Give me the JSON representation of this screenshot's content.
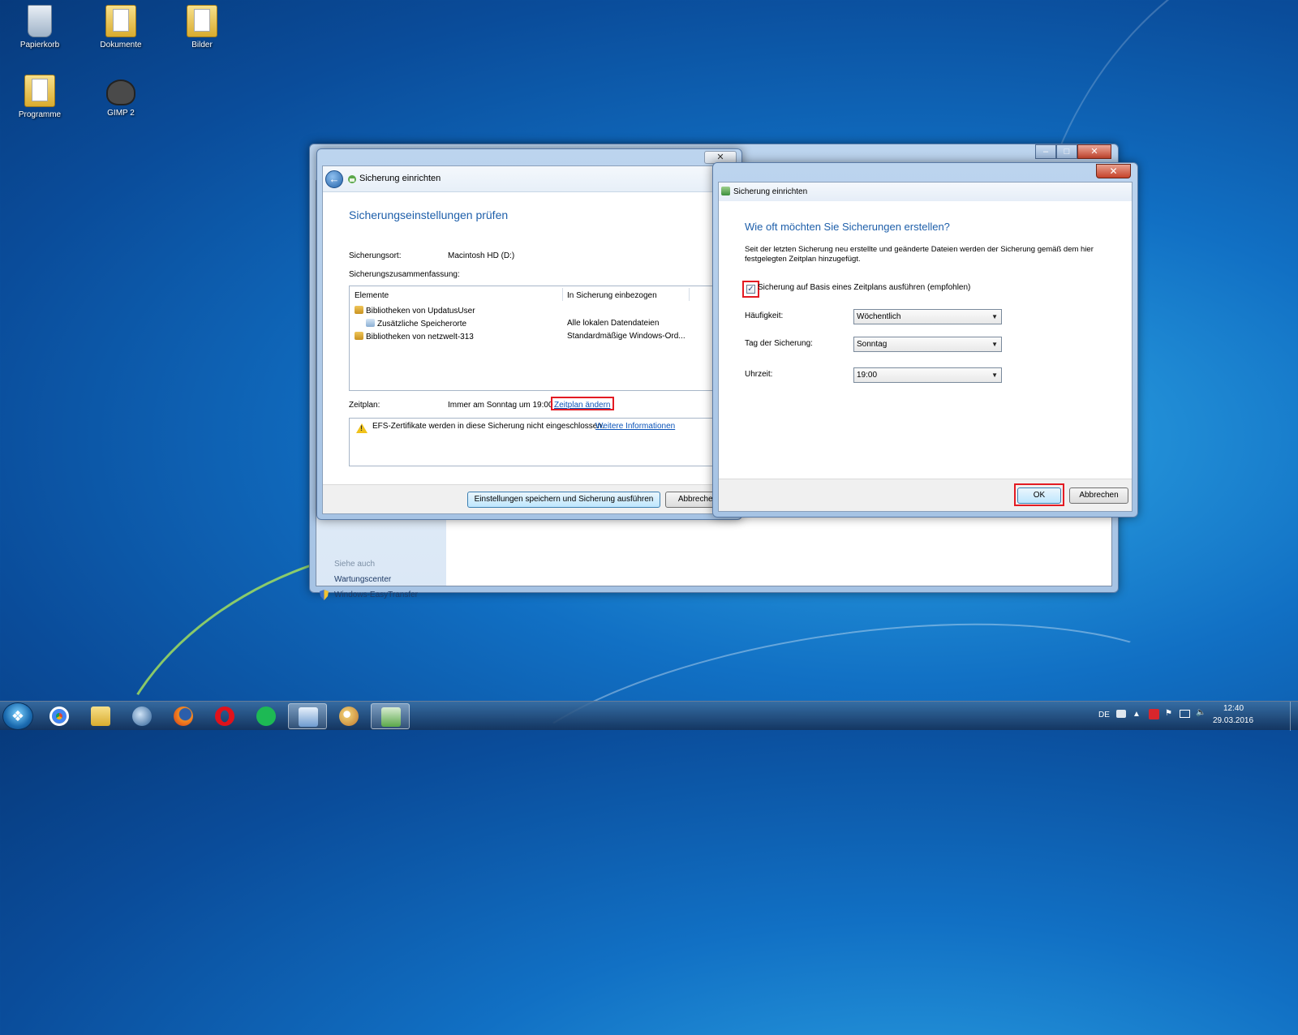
{
  "desktop": {
    "icons": [
      {
        "label": "Papierkorb"
      },
      {
        "label": "Dokumente"
      },
      {
        "label": "Bilder"
      },
      {
        "label": "Programme"
      },
      {
        "label": "GIMP 2"
      }
    ]
  },
  "main_window": {
    "see_also": {
      "title": "Siehe auch",
      "items": [
        "Wartungscenter",
        "Windows-EasyTransfer"
      ]
    }
  },
  "wizard": {
    "title": "Sicherung einrichten",
    "heading": "Sicherungseinstellungen prüfen",
    "location_label": "Sicherungsort:",
    "location_value": "Macintosh HD (D:)",
    "summary_label": "Sicherungszusammenfassung:",
    "columns": [
      "Elemente",
      "In Sicherung einbezogen"
    ],
    "rows": [
      {
        "item": "Bibliotheken von UpdatusUser",
        "included": ""
      },
      {
        "item": "Zusätzliche Speicherorte",
        "included": "Alle lokalen Datendateien"
      },
      {
        "item": "Bibliotheken von netzwelt-313",
        "included": "Standardmäßige Windows-Ord..."
      }
    ],
    "schedule_label": "Zeitplan:",
    "schedule_value": "Immer am Sonntag um 19:00",
    "schedule_link": "Zeitplan ändern",
    "warning_text": "EFS-Zertifikate werden in diese Sicherung nicht eingeschlossen.",
    "warning_link": "Weitere Informationen",
    "save_button": "Einstellungen speichern und Sicherung ausführen",
    "cancel_button": "Abbrechen"
  },
  "schedule_dialog": {
    "title": "Sicherung einrichten",
    "heading": "Wie oft möchten Sie Sicherungen erstellen?",
    "description": "Seit der letzten Sicherung neu erstellte und geänderte Dateien werden der Sicherung gemäß dem hier festgelegten Zeitplan hinzugefügt.",
    "checkbox_label": "Sicherung auf Basis eines Zeitplans ausführen (empfohlen)",
    "checkbox_checked": true,
    "frequency_label": "Häufigkeit:",
    "frequency_value": "Wöchentlich",
    "day_label": "Tag der Sicherung:",
    "day_value": "Sonntag",
    "time_label": "Uhrzeit:",
    "time_value": "19:00",
    "ok_button": "OK",
    "cancel_button": "Abbrechen"
  },
  "taskbar": {
    "apps": [
      "start-orb",
      "chrome-icon",
      "explorer-icon",
      "thunderbird-icon",
      "firefox-icon",
      "opera-icon",
      "spotify-icon",
      "control-panel-icon",
      "paint-icon",
      "backup-icon"
    ],
    "language": "DE",
    "time": "12:40",
    "date": "29.03.2016"
  },
  "colors": {
    "highlight_red": "#e31b23",
    "heading_blue": "#1e5faa",
    "link_blue": "#0a53b8"
  }
}
